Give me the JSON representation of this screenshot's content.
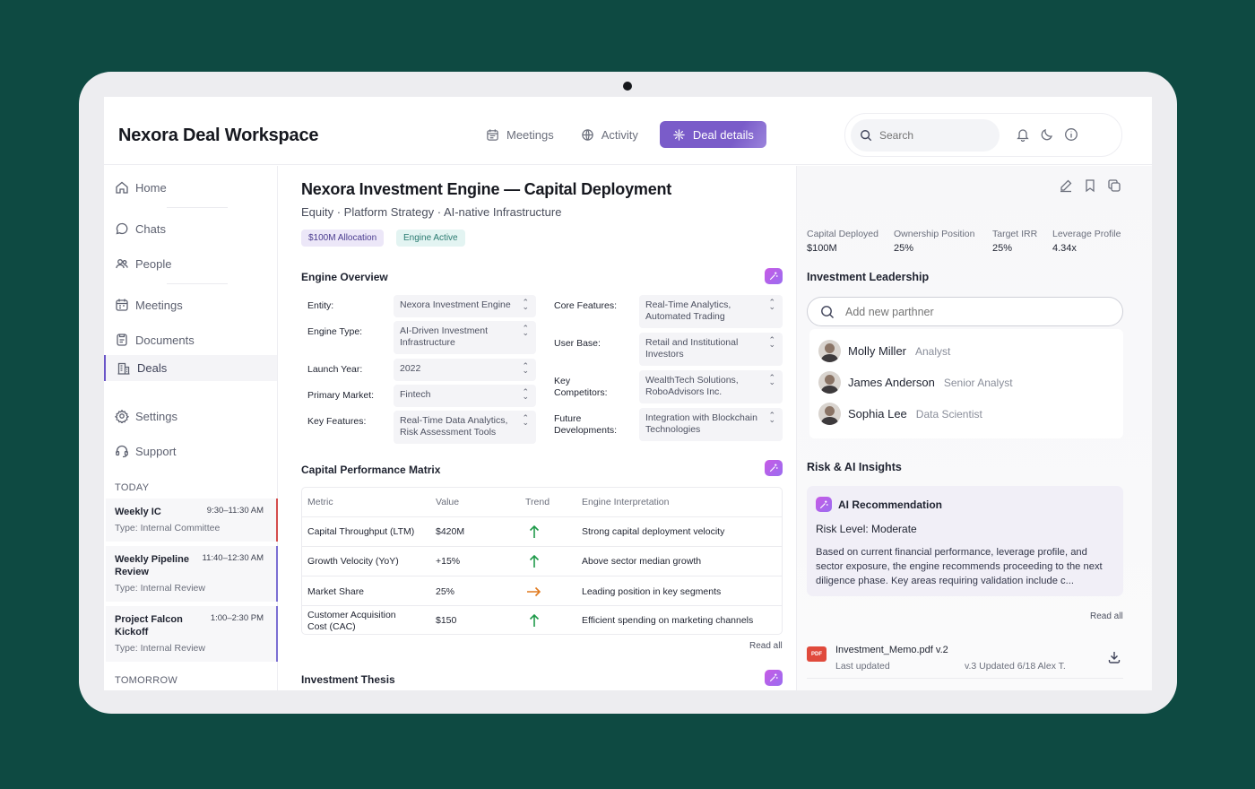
{
  "header": {
    "app_title": "Nexora Deal Workspace",
    "nav": [
      {
        "label": "Meetings",
        "icon": "calendar-icon",
        "active": false
      },
      {
        "label": "Activity",
        "icon": "globe-icon",
        "active": false
      },
      {
        "label": "Deal details",
        "icon": "sparkle-icon",
        "active": true
      }
    ],
    "search_placeholder": "Search"
  },
  "sidebar": {
    "items": [
      {
        "label": "Home",
        "icon": "home-icon"
      },
      {
        "label": "Chats",
        "icon": "chat-icon"
      },
      {
        "label": "People",
        "icon": "people-icon"
      },
      {
        "label": "Meetings",
        "icon": "calendar-icon"
      },
      {
        "label": "Documents",
        "icon": "document-icon"
      },
      {
        "label": "Deals",
        "icon": "building-icon",
        "active": true
      },
      {
        "label": "Settings",
        "icon": "gear-icon"
      },
      {
        "label": "Support",
        "icon": "headset-icon"
      }
    ],
    "today_label": "TODAY",
    "tomorrow_label": "TOMORROW",
    "meetings": [
      {
        "title": "Weekly IC",
        "time": "9:30–11:30 AM",
        "type": "Type: Internal Committee"
      },
      {
        "title": "Weekly Pipeline Review",
        "time": "11:40–12:30 AM",
        "type": "Type: Internal Review"
      },
      {
        "title": "Project Falcon Kickoff",
        "time": "1:00–2:30 PM",
        "type": "Type: Internal Review"
      }
    ]
  },
  "deal": {
    "title": "Nexora Investment Engine — Capital Deployment",
    "subtitle": "Equity · Platform Strategy · AI-native Infrastructure",
    "chips": [
      "$100M Allocation",
      "Engine Active"
    ],
    "engine_overview_title": "Engine Overview",
    "fields_left": [
      {
        "label": "Entity:",
        "value": "Nexora Investment Engine"
      },
      {
        "label": "Engine Type:",
        "value": "AI-Driven Investment Infrastructure"
      },
      {
        "label": "Launch Year:",
        "value": "2022"
      },
      {
        "label": "Primary Market:",
        "value": "Fintech"
      },
      {
        "label": "Key Features:",
        "value": "Real-Time Data Analytics, Risk Assessment Tools"
      }
    ],
    "fields_right": [
      {
        "label": "Core Features:",
        "value": "Real-Time Analytics, Automated Trading"
      },
      {
        "label": "User Base:",
        "value": "Retail and Institutional Investors"
      },
      {
        "label": "Key Competitors:",
        "value": "WealthTech Solutions, RoboAdvisors Inc."
      },
      {
        "label": "Future Developments:",
        "value": "Integration with Blockchain Technologies"
      }
    ],
    "matrix_title": "Capital Performance Matrix",
    "matrix_headers": [
      "Metric",
      "Value",
      "Trend",
      "Engine Interpretation"
    ],
    "matrix_rows": [
      {
        "metric": "Capital Throughput (LTM)",
        "value": "$420M",
        "trend": "up",
        "interpretation": "Strong capital deployment velocity"
      },
      {
        "metric": "Growth Velocity (YoY)",
        "value": "+15%",
        "trend": "up",
        "interpretation": "Above sector median growth"
      },
      {
        "metric": "Market Share",
        "value": "25%",
        "trend": "flat",
        "interpretation": "Leading position in key segments"
      },
      {
        "metric": "Customer Acquisition Cost (CAC)",
        "value": "$150",
        "trend": "up",
        "interpretation": "Efficient spending on marketing channels"
      }
    ],
    "read_all": "Read all",
    "thesis_title": "Investment Thesis"
  },
  "right_panel": {
    "stats": [
      {
        "label": "Capital Deployed",
        "value": "$100M"
      },
      {
        "label": "Ownership Position",
        "value": "25%"
      },
      {
        "label": "Target IRR",
        "value": "25%"
      },
      {
        "label": "Leverage Profile",
        "value": "4.34x"
      }
    ],
    "leadership_title": "Investment Leadership",
    "partner_placeholder": "Add new parthner",
    "people": [
      {
        "name": "Molly Miller",
        "role": "Analyst"
      },
      {
        "name": "James Anderson",
        "role": "Senior Analyst"
      },
      {
        "name": "Sophia Lee",
        "role": "Data Scientist"
      }
    ],
    "risk_title": "Risk & AI Insights",
    "ai_title": "AI Recommendation",
    "risk_label": "Risk Level:",
    "risk_value": "Moderate",
    "ai_text": "Based on current financial performance, leverage profile, and sector exposure, the engine recommends proceeding to the next diligence phase. Key areas requiring validation include c...",
    "read_all": "Read all",
    "file": {
      "badge": "PDF",
      "name": "Investment_Memo.pdf v.2",
      "sub": "Last updated",
      "version": "v.3 Updated 6/18 Alex T."
    }
  },
  "colors": {
    "accent": "#7a5cc9",
    "background": "#0e4a42",
    "trend_up": "#1f9a4a",
    "trend_flat": "#e07a1f",
    "meeting_red": "#d44d4d"
  }
}
